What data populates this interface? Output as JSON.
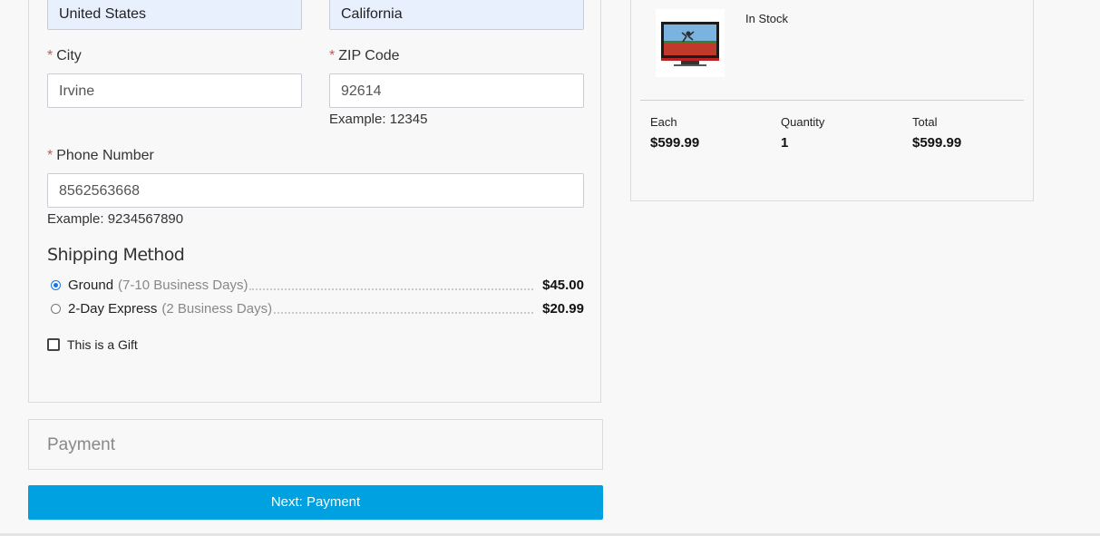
{
  "address": {
    "country_value": "United States",
    "state_value": "California",
    "required_mark": "*",
    "city_label": "City",
    "city_value": "Irvine",
    "zip_label": "ZIP Code",
    "zip_value": "92614",
    "zip_hint": "Example: 12345",
    "phone_label": "Phone Number",
    "phone_value": "8562563668",
    "phone_hint": "Example: 9234567890"
  },
  "shipping": {
    "heading": "Shipping Method",
    "options": [
      {
        "name": "Ground",
        "days": "(7-10 Business Days)",
        "price": "$45.00",
        "selected": true
      },
      {
        "name": "2-Day Express",
        "days": "(2 Business Days)",
        "price": "$20.99",
        "selected": false
      }
    ],
    "gift_label": "This is a Gift",
    "gift_checked": false
  },
  "payment": {
    "title": "Payment"
  },
  "next_button_label": "Next: Payment",
  "summary": {
    "stock_status": "In Stock",
    "each_label": "Each",
    "each_value": "$599.99",
    "quantity_label": "Quantity",
    "quantity_value": "1",
    "total_label": "Total",
    "total_value": "$599.99"
  },
  "colors": {
    "accent": "#00a1e0",
    "required": "#d9534f",
    "autofill_bg": "#e8f0fe"
  }
}
